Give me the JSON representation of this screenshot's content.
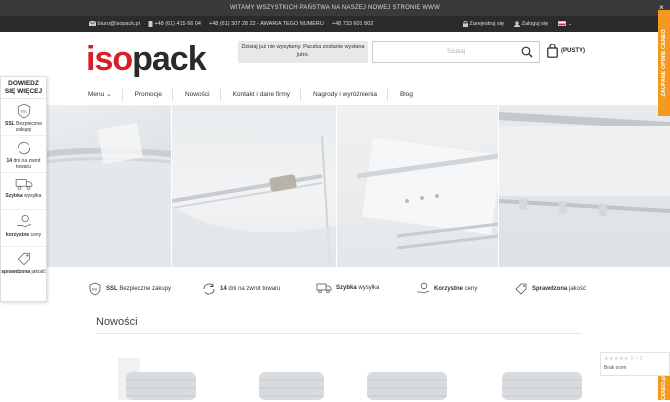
{
  "topbar": {
    "message": "WITAMY WSZYSTKICH PAŃSTWA NA NASZEJ NOWEJ STRONIE WWW",
    "close": "×"
  },
  "contact": {
    "email": "biuro@isopack.pl",
    "phone1": "+48 (61) 415 66 04",
    "phone2": "+48 (61) 307 28 22 - AWARIA TEGO NUMERU",
    "phone3": "+48 733 601 802",
    "register": "Zarejestruj się",
    "login": "Zaloguj się",
    "lang": "PL"
  },
  "header": {
    "logo_iso": "iso",
    "logo_pack": "pack",
    "ship_note": "Dzisiaj już nie wysyłamy. Paczka zostanie wysłana jutro.",
    "search_placeholder": "Szukaj",
    "cart_label": "(PUSTY)"
  },
  "nav": [
    "Menu",
    "Promocje",
    "Nowości",
    "Kontakt i dane firmy",
    "Nagrody i wyróżnienia",
    "Blog"
  ],
  "badges": [
    {
      "bold": "SSL",
      "text": " Bezpieczne zakupy"
    },
    {
      "bold": "14",
      "text": " dni na zwrot towaru"
    },
    {
      "bold": "Szybka",
      "text": " wysyłka"
    },
    {
      "bold": "Korzystne",
      "text": " ceny"
    },
    {
      "bold": "Sprawdzona",
      "text": " jakość"
    }
  ],
  "section_title": "Nowości",
  "sidebar": {
    "title": "DOWIEDZ SIĘ WIĘCEJ",
    "items": [
      {
        "bold": "SSL",
        "text": " Bezpieczne zakupy"
      },
      {
        "bold": "14",
        "text": " dni na zwrot towaru"
      },
      {
        "bold": "Szybka",
        "text": " wysyłka"
      },
      {
        "bold": "korzystne",
        "text": " ceny"
      },
      {
        "bold": "sprawdzona",
        "text": " jakość"
      }
    ]
  },
  "right_tab": "ZAUFANE OPINIE CENEO",
  "right_tab_bottom": "CENEO.pl",
  "rating": {
    "stars": "★★★★★",
    "score": "0 / 5",
    "text": "Brak ocen"
  },
  "colors": {
    "brand_red": "#d81f26",
    "dark": "#2b2b2b",
    "orange": "#f29a1e"
  }
}
